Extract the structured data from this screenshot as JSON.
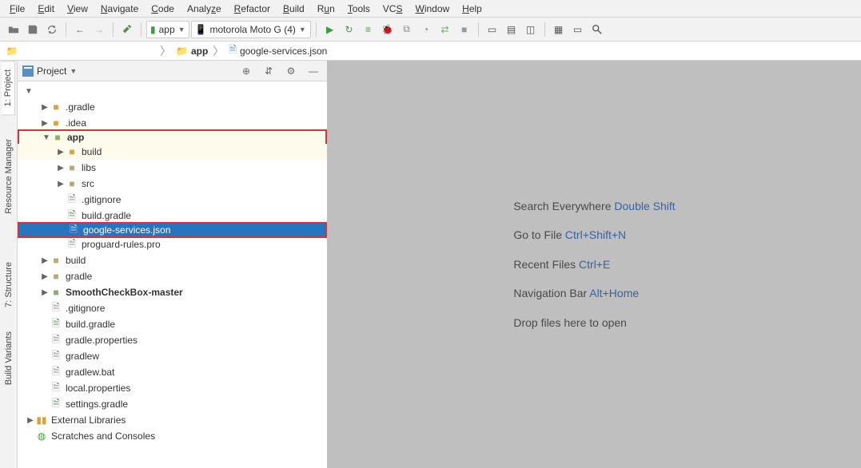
{
  "menu": [
    "File",
    "Edit",
    "View",
    "Navigate",
    "Code",
    "Analyze",
    "Refactor",
    "Build",
    "Run",
    "Tools",
    "VCS",
    "Window",
    "Help"
  ],
  "toolbar": {
    "module": "app",
    "device": "motorola Moto G (4)"
  },
  "breadcrumb": {
    "app": "app",
    "file": "google-services.json"
  },
  "panel": {
    "title": "Project"
  },
  "tree": {
    "gradle_folder": ".gradle",
    "idea_folder": ".idea",
    "app": "app",
    "build": "build",
    "libs": "libs",
    "src": "src",
    "gitignore": ".gitignore",
    "build_gradle": "build.gradle",
    "google_services": "google-services.json",
    "proguard": "proguard-rules.pro",
    "build2": "build",
    "gradle2": "gradle",
    "smooth": "SmoothCheckBox-master",
    "gitignore2": ".gitignore",
    "build_gradle2": "build.gradle",
    "gradle_props": "gradle.properties",
    "gradlew": "gradlew",
    "gradlew_bat": "gradlew.bat",
    "local_props": "local.properties",
    "settings_gradle": "settings.gradle",
    "ext_libs": "External Libraries",
    "scratches": "Scratches and Consoles"
  },
  "hints": {
    "l1a": "Search Everywhere ",
    "l1b": "Double Shift",
    "l2a": "Go to File ",
    "l2b": "Ctrl+Shift+N",
    "l3a": "Recent Files ",
    "l3b": "Ctrl+E",
    "l4a": "Navigation Bar ",
    "l4b": "Alt+Home",
    "l5": "Drop files here to open"
  },
  "gutter": {
    "project": "1: Project",
    "resource": "Resource Manager",
    "structure": "7: Structure",
    "variants": "Build Variants"
  }
}
